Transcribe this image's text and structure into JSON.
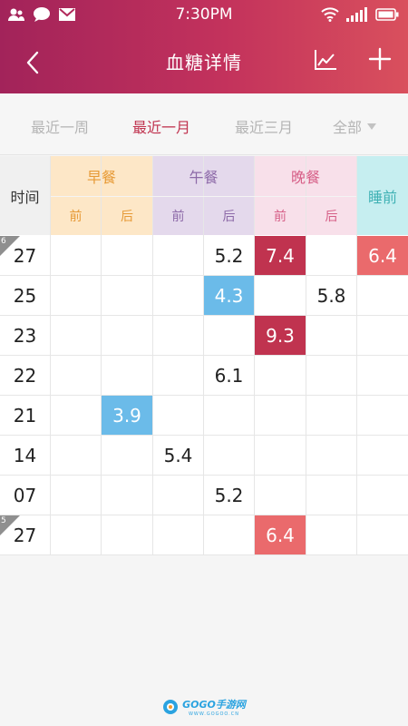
{
  "status": {
    "time": "7:30PM"
  },
  "nav": {
    "title": "血糖详情"
  },
  "tabs": [
    {
      "label": "最近一周",
      "active": false
    },
    {
      "label": "最近一月",
      "active": true
    },
    {
      "label": "最近三月",
      "active": false
    },
    {
      "label": "全部",
      "active": false
    }
  ],
  "table": {
    "time_header": "时间",
    "meals": {
      "breakfast": "早餐",
      "lunch": "午餐",
      "dinner": "晚餐",
      "bedtime": "睡前"
    },
    "before": "前",
    "after": "后",
    "rows": [
      {
        "month_marker": "6",
        "date": "27",
        "bf_before": "",
        "bf_after": "",
        "lu_before": "",
        "lu_after": "5.2",
        "di_before": "7.4",
        "di_after": "",
        "bedtime": "6.4"
      },
      {
        "month_marker": "",
        "date": "25",
        "bf_before": "",
        "bf_after": "",
        "lu_before": "",
        "lu_after": "4.3",
        "di_before": "",
        "di_after": "5.8",
        "bedtime": ""
      },
      {
        "month_marker": "",
        "date": "23",
        "bf_before": "",
        "bf_after": "",
        "lu_before": "",
        "lu_after": "",
        "di_before": "9.3",
        "di_after": "",
        "bedtime": ""
      },
      {
        "month_marker": "",
        "date": "22",
        "bf_before": "",
        "bf_after": "",
        "lu_before": "",
        "lu_after": "6.1",
        "di_before": "",
        "di_after": "",
        "bedtime": ""
      },
      {
        "month_marker": "",
        "date": "21",
        "bf_before": "",
        "bf_after": "3.9",
        "lu_before": "",
        "lu_after": "",
        "di_before": "",
        "di_after": "",
        "bedtime": ""
      },
      {
        "month_marker": "",
        "date": "14",
        "bf_before": "",
        "bf_after": "",
        "lu_before": "5.4",
        "lu_after": "",
        "di_before": "",
        "di_after": "",
        "bedtime": ""
      },
      {
        "month_marker": "",
        "date": "07",
        "bf_before": "",
        "bf_after": "",
        "lu_before": "",
        "lu_after": "5.2",
        "di_before": "",
        "di_after": "",
        "bedtime": ""
      },
      {
        "month_marker": "5",
        "date": "27",
        "bf_before": "",
        "bf_after": "",
        "lu_before": "",
        "lu_after": "",
        "di_before": "6.4",
        "di_after": "",
        "bedtime": ""
      }
    ],
    "highlights": {
      "hi": "#c0334f",
      "mid": "#ea6a6c",
      "lo": "#6bbbe9"
    }
  },
  "icons": {
    "status_left": [
      "contacts-icon",
      "chat-bubble-icon",
      "mail-icon"
    ],
    "status_right": [
      "wifi-icon",
      "signal-icon",
      "battery-icon"
    ],
    "nav": [
      "back-icon",
      "line-chart-icon",
      "plus-icon"
    ]
  },
  "watermark": {
    "logo_text": "GOGO手游网",
    "sub_text": "WWW.GOGOO.CN"
  }
}
